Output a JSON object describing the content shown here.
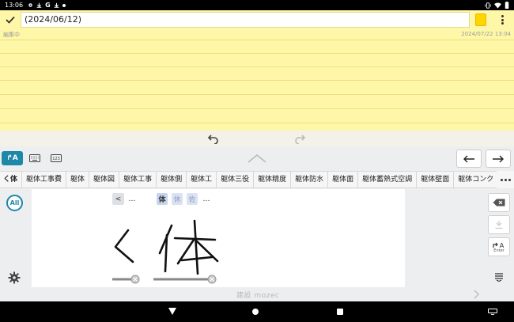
{
  "status_bar": {
    "time": "13:06",
    "status_icons": [
      "gear-icon",
      "download-icon",
      "google-icon",
      "download-icon",
      "dot-icon"
    ],
    "right_icons": [
      "vibrate-icon",
      "wifi-icon",
      "battery-icon"
    ]
  },
  "note": {
    "title_value": "(2024/06/12)",
    "state_label": "編集中",
    "timestamp": "2024/07/22 13:04",
    "background_color": "#fff7a8",
    "selected_color": "#ffd500"
  },
  "keyboard": {
    "mode_handwriting_label": "↱A",
    "candidates": [
      "く体",
      "躯体工事費",
      "躯体",
      "躯体図",
      "躯体工事",
      "躯体側",
      "躯体工",
      "躯体三役",
      "躯体精度",
      "躯体防水",
      "躯体面",
      "躯体蓄熱式空調",
      "躯体壁面",
      "躯体コンク"
    ],
    "all_label": "All",
    "segments": {
      "back": "<",
      "ellipsis_left": "…",
      "kanji_1": "体",
      "kanji_2": "休",
      "kanji_3": "佐",
      "ellipsis_right": "…"
    },
    "enter_label": "Enter",
    "brand": "建設 mozec",
    "accent_color": "#1e88a8"
  },
  "nav_bar": {
    "icons": [
      "back-icon",
      "home-icon",
      "recents-icon",
      "keyboard-icon"
    ]
  }
}
